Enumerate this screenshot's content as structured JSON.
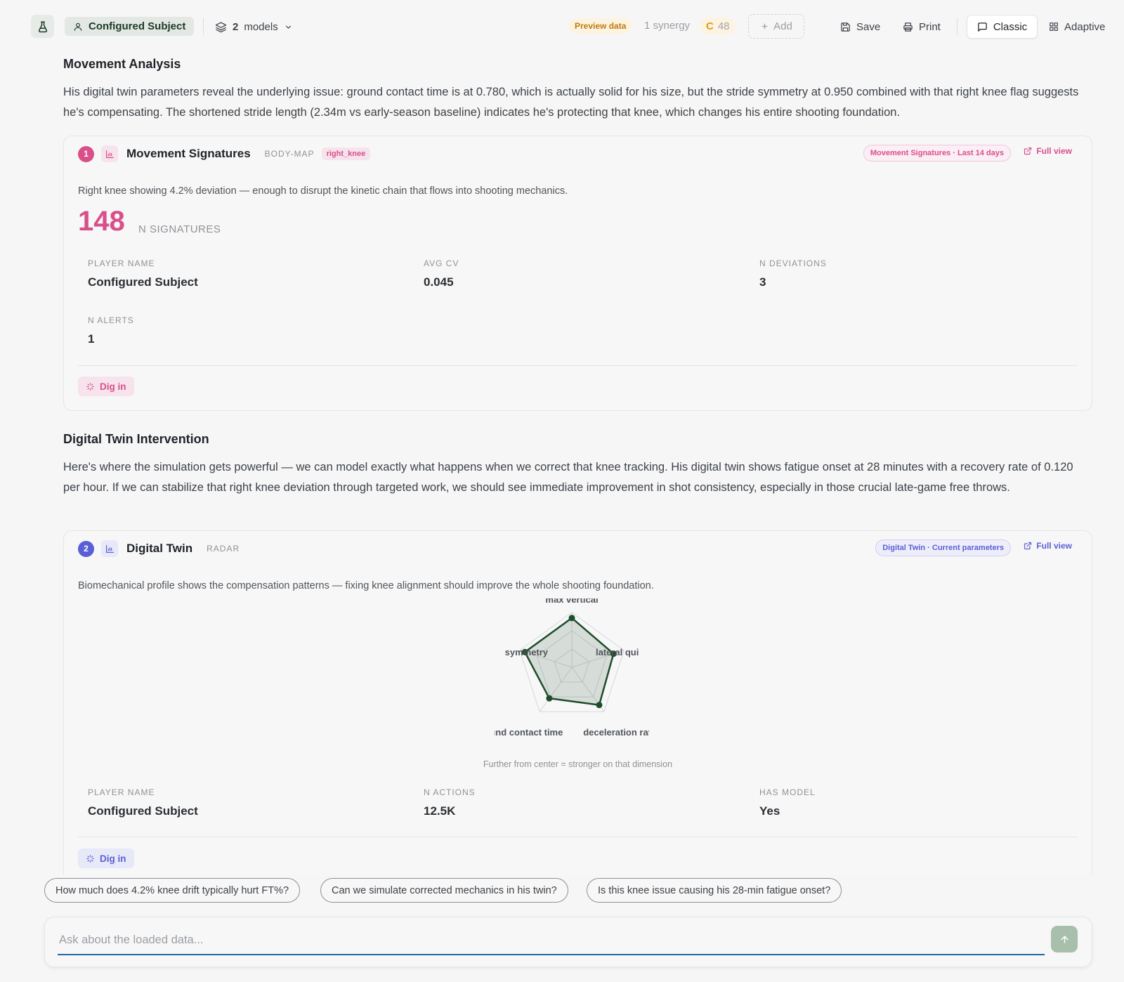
{
  "topbar": {
    "subject": "Configured Subject",
    "models_count": "2",
    "models_label": "models",
    "preview_label": "Preview data",
    "synergy_label": "1 synergy",
    "c_letter": "C",
    "c_value": "48",
    "add_label": "Add",
    "save_label": "Save",
    "print_label": "Print",
    "classic_label": "Classic",
    "adaptive_label": "Adaptive"
  },
  "section1": {
    "title": "Movement Analysis",
    "text": "His digital twin parameters reveal the underlying issue: ground contact time is at 0.780, which is actually solid for his size, but the stride symmetry at 0.950 combined with that right knee flag suggests he's compensating. The shortened stride length (2.34m vs early-season baseline) indicates he's protecting that knee, which changes his entire shooting foundation."
  },
  "card1": {
    "number": "1",
    "title": "Movement Signatures",
    "type": "BODY-MAP",
    "tag": "right_knee",
    "meta": "Movement Signatures · Last 14 days",
    "full_view": "Full view",
    "description": "Right knee showing 4.2% deviation — enough to disrupt the kinetic chain that flows into shooting mechanics.",
    "big_value": "148",
    "big_label": "N SIGNATURES",
    "stats": [
      {
        "label": "PLAYER NAME",
        "value": "Configured Subject"
      },
      {
        "label": "AVG CV",
        "value": "0.045"
      },
      {
        "label": "N DEVIATIONS",
        "value": "3"
      },
      {
        "label": "N ALERTS",
        "value": "1"
      }
    ],
    "dig_in": "Dig in",
    "accent": "#d94f8a"
  },
  "section2": {
    "title": "Digital Twin Intervention",
    "text": "Here's where the simulation gets powerful — we can model exactly what happens when we correct that knee tracking. His digital twin shows fatigue onset at 28 minutes with a recovery rate of 0.120 per hour. If we can stabilize that right knee deviation through targeted work, we should see immediate improvement in shot consistency, especially in those crucial late-game free throws."
  },
  "card2": {
    "number": "2",
    "title": "Digital Twin",
    "type": "RADAR",
    "meta": "Digital Twin · Current parameters",
    "full_view": "Full view",
    "description": "Biomechanical profile shows the compensation patterns — fixing knee alignment should improve the whole shooting foundation.",
    "radar_caption": "Further from center = stronger on that dimension",
    "stats": [
      {
        "label": "PLAYER NAME",
        "value": "Configured Subject"
      },
      {
        "label": "N ACTIONS",
        "value": "12.5K"
      },
      {
        "label": "HAS MODEL",
        "value": "Yes"
      }
    ],
    "dig_in": "Dig in",
    "accent": "#5b5fd6"
  },
  "chart_data": {
    "type": "radar",
    "axes": [
      "max vertical",
      "lateral qui",
      "deceleration rat",
      "und contact time",
      "symmetry"
    ],
    "values": [
      0.9,
      0.8,
      0.85,
      0.7,
      0.9
    ],
    "max": 1,
    "levels": 3,
    "fill_color": "#1e4d2b",
    "line_color": "#1e4d2b"
  },
  "suggestions": [
    "How much does 4.2% knee drift typically hurt FT%?",
    "Can we simulate corrected mechanics in his twin?",
    "Is this knee issue causing his 28-min fatigue onset?"
  ],
  "ask": {
    "placeholder": "Ask about the loaded data..."
  }
}
